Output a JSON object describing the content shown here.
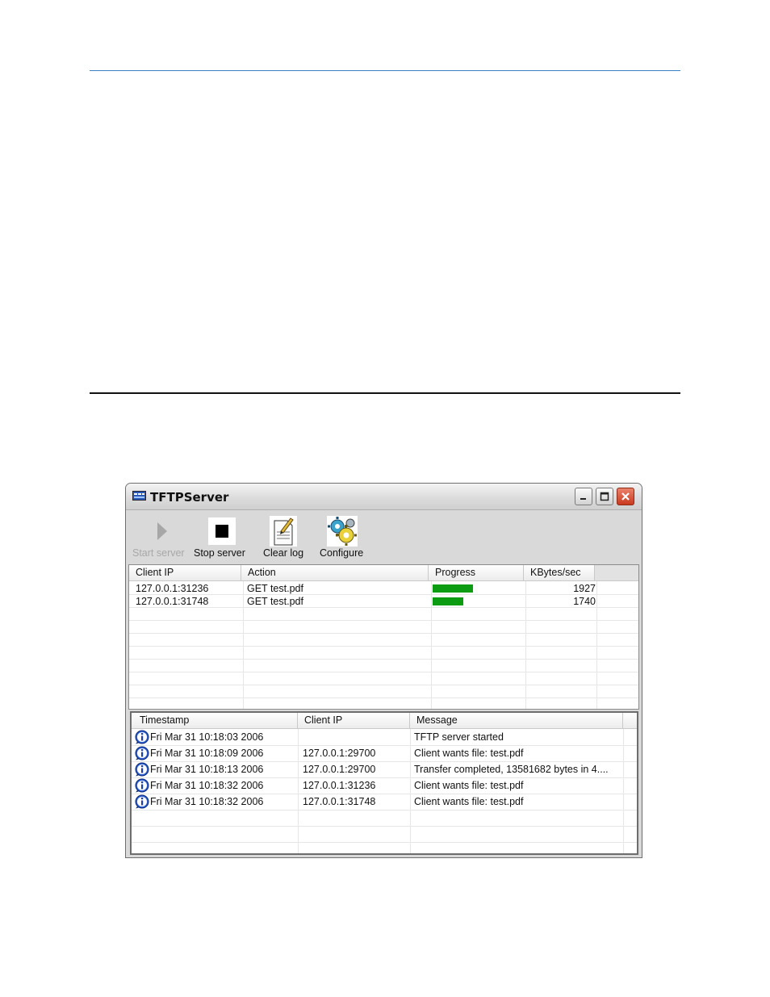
{
  "window": {
    "title": "TFTPServer"
  },
  "toolbar": {
    "start_label": "Start server",
    "stop_label": "Stop server",
    "clear_label": "Clear log",
    "configure_label": "Configure"
  },
  "transfers": {
    "columns": [
      "Client IP",
      "Action",
      "Progress",
      "KBytes/sec"
    ],
    "rows": [
      {
        "client_ip": "127.0.0.1:31236",
        "action": "GET test.pdf",
        "progress": 0.44,
        "kbytes_sec": "1927"
      },
      {
        "client_ip": "127.0.0.1:31748",
        "action": "GET test.pdf",
        "progress": 0.33,
        "kbytes_sec": "1740"
      }
    ]
  },
  "log": {
    "columns": [
      "Timestamp",
      "Client IP",
      "Message"
    ],
    "rows": [
      {
        "icon": "info-icon",
        "timestamp": "Fri Mar 31 10:18:03 2006",
        "client_ip": "",
        "message": "TFTP server started"
      },
      {
        "icon": "info-icon",
        "timestamp": "Fri Mar 31 10:18:09 2006",
        "client_ip": "127.0.0.1:29700",
        "message": "Client wants file: test.pdf"
      },
      {
        "icon": "info-icon",
        "timestamp": "Fri Mar 31 10:18:13 2006",
        "client_ip": "127.0.0.1:29700",
        "message": "Transfer completed, 13581682 bytes in 4...."
      },
      {
        "icon": "info-icon",
        "timestamp": "Fri Mar 31 10:18:32 2006",
        "client_ip": "127.0.0.1:31236",
        "message": "Client wants file: test.pdf"
      },
      {
        "icon": "info-icon",
        "timestamp": "Fri Mar 31 10:18:32 2006",
        "client_ip": "127.0.0.1:31748",
        "message": "Client wants file: test.pdf"
      }
    ]
  },
  "colors": {
    "progress_bar": "#0c9c12",
    "close_button": "#c9391e",
    "top_rule": "#3a7fc1"
  }
}
